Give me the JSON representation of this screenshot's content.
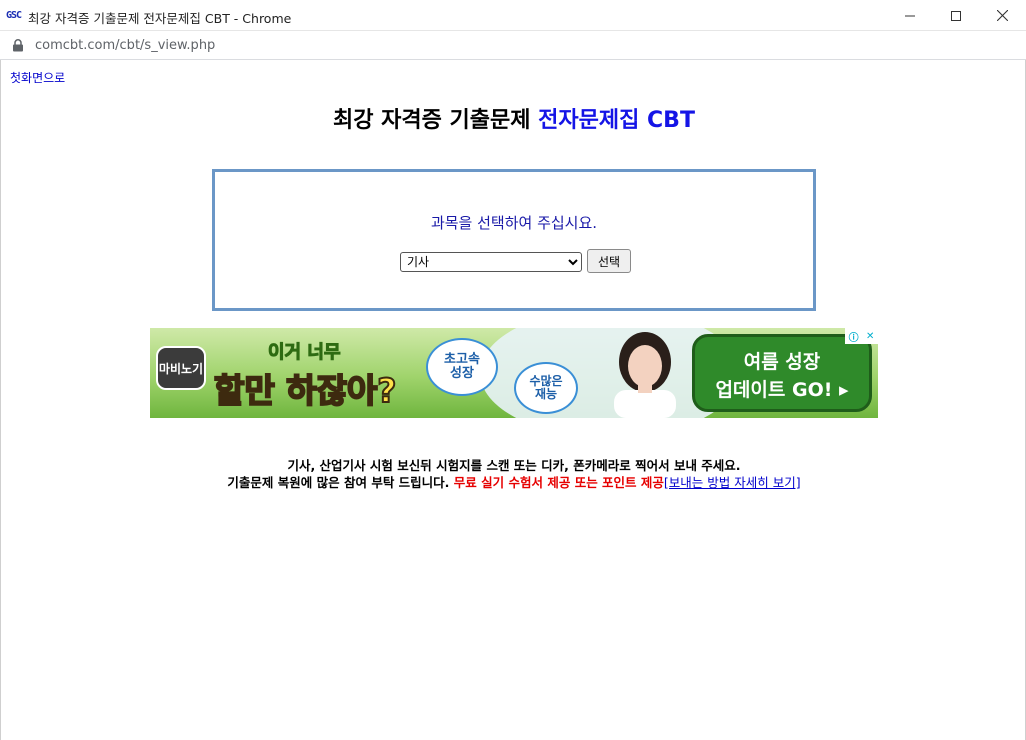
{
  "window": {
    "favicon_text": "GSC",
    "title": "최강 자격증 기출문제 전자문제집 CBT - Chrome"
  },
  "address_bar": {
    "url": "comcbt.com/cbt/s_view.php"
  },
  "page": {
    "home_link": "첫화면으로",
    "heading_part1": "최강 자격증 기출문제 ",
    "heading_part2": "전자문제집 CBT",
    "prompt": "과목을 선택하여 주십시요.",
    "subject_select_value": "기사",
    "select_button": "선택"
  },
  "ad": {
    "logo": "마비노기",
    "line1": "이거 너무",
    "line2": "할만 하잖아?",
    "bubble1": [
      "초고속",
      "성장"
    ],
    "bubble2": [
      "수많은",
      "재능"
    ],
    "cta_line1": "여름 성장",
    "cta_line2": "업데이트 GO! ▸",
    "choices_i": "ⓘ",
    "choices_x": "✕"
  },
  "notice": {
    "line1": "기사, 산업기사 시험 보신뒤 시험지를 스캔 또는 디카, 폰카메라로 찍어서 보내 주세요.",
    "line2_black": "기출문제 복원에 많은 참여 부탁 드립니다. ",
    "line2_red": "무료 실기 수험서 제공 또는 포인트 제공",
    "line2_link": "[보내는 방법 자세히 보기]"
  },
  "colors": {
    "heading_accent": "#1414e6",
    "box_border": "#6b97c7",
    "notice_red": "#e60000",
    "link": "#0000cc"
  }
}
